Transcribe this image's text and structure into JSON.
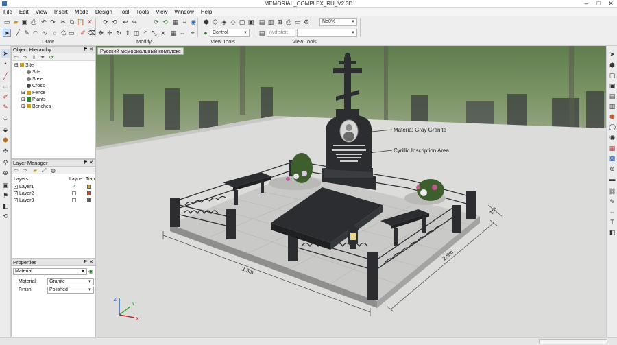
{
  "window": {
    "title": "MEMORIAL_COMPLEX_RU_V2.3D",
    "controls": {
      "minimize": "–",
      "maximize": "□",
      "close": "✕"
    }
  },
  "menu": [
    "File",
    "Edit",
    "View",
    "Insert",
    "Mode",
    "Design",
    "Tool",
    "Tools",
    "View",
    "Window",
    "Help"
  ],
  "toolbar": {
    "groups": [
      "Draw",
      "Modify",
      "View Tools",
      "View Tools"
    ],
    "control_combo": "Control",
    "nvd_combo": "nvd:sfert",
    "zoom_combo": "No0%"
  },
  "object_hierarchy": {
    "title": "Object Hierarchy",
    "items": [
      {
        "label": "Site",
        "level": 0,
        "expander": "⊟",
        "icon": "folder-icon"
      },
      {
        "label": "Site",
        "level": 1,
        "expander": "",
        "icon": "node-icon"
      },
      {
        "label": "Stele",
        "level": 1,
        "expander": "",
        "icon": "node-icon"
      },
      {
        "label": "Cross",
        "level": 1,
        "expander": "",
        "icon": "cross-icon"
      },
      {
        "label": "Fence",
        "level": 1,
        "expander": "⊞",
        "icon": "folder-icon"
      },
      {
        "label": "Plants",
        "level": 1,
        "expander": "⊞",
        "icon": "plant-icon"
      },
      {
        "label": "Benches",
        "level": 1,
        "expander": "⊞",
        "icon": "folder-icon"
      }
    ]
  },
  "layer_manager": {
    "title": "Layer Manager",
    "columns": [
      "Layers",
      "Layne",
      "Tiap"
    ],
    "layers": [
      {
        "name": "Layer1",
        "checked": "✓",
        "visible": "✓",
        "color": "#c8a040"
      },
      {
        "name": "Layer2",
        "checked": "✓",
        "visible": "",
        "color": "#c05030"
      },
      {
        "name": "Layer3",
        "checked": "✓",
        "visible": "",
        "color": "#555555"
      }
    ]
  },
  "properties": {
    "title": "Properties",
    "selector": "Material",
    "fields": [
      {
        "label": "Material:",
        "value": "Granite"
      },
      {
        "label": "Finish:",
        "value": "Polished"
      }
    ]
  },
  "viewport": {
    "tab_label": "Русский мемориальный комплекс",
    "annotations": [
      "Materia: Gray Granite",
      "Cyrillic Inscription Area"
    ],
    "dimensions": [
      "3.5m",
      "2.5m",
      "1m"
    ],
    "axes": [
      "Z",
      "Y",
      "X"
    ]
  },
  "colors": {
    "granite_dark": "#2b2d30",
    "granite_light": "#bdbdbd",
    "paving": "#c9c9c7",
    "background_ground": "#dcdcda"
  }
}
